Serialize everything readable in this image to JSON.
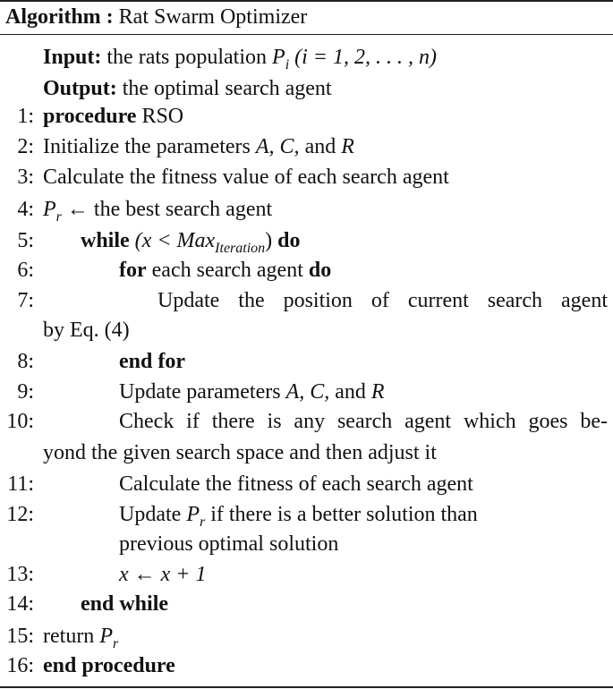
{
  "algorithm": {
    "label": "Algorithm :",
    "name": "Rat Swarm Optimizer"
  },
  "input": {
    "label": "Input:",
    "text_pre": "the rats population",
    "var": "P",
    "sub": "i",
    "range_text": "(i = 1, 2, . . . , n)"
  },
  "output": {
    "label": "Output:",
    "text": "the optimal search agent"
  },
  "lines": {
    "l1": {
      "num": "1:",
      "kw": "procedure",
      "text": "RSO"
    },
    "l2": {
      "num": "2:",
      "text": "Initialize the parameters",
      "vars": "A, C,",
      "and": "and",
      "var_r": "R"
    },
    "l3": {
      "num": "3:",
      "text": "Calculate the fitness value of each search agent"
    },
    "l4": {
      "num": "4:",
      "var": "P",
      "sub": "r",
      "text": "← the best search agent"
    },
    "l5": {
      "num": "5:",
      "kw": "while",
      "cond_open": "(x <",
      "cond_var": "Max",
      "cond_sub": "Iteration",
      "cond_close": ")",
      "kw2": "do"
    },
    "l6": {
      "num": "6:",
      "kw": "for",
      "text": "each search agent",
      "kw2": "do"
    },
    "l7": {
      "num": "7:",
      "text": "Update the position of current search agent",
      "cont": "by Eq. (4)"
    },
    "l8": {
      "num": "8:",
      "kw": "end for"
    },
    "l9": {
      "num": "9:",
      "text": "Update parameters",
      "vars": "A, C,",
      "and": "and",
      "var_r": "R"
    },
    "l10": {
      "num": "10:",
      "text": "Check if there is any search agent which goes be-",
      "cont": "yond the given search space and then adjust it"
    },
    "l11": {
      "num": "11:",
      "text": "Calculate the fitness of each search agent"
    },
    "l12": {
      "num": "12:",
      "text_pre": "Update",
      "var": "P",
      "sub": "r",
      "text_post": "if there is a better solution than",
      "cont": "previous optimal solution"
    },
    "l13": {
      "num": "13:",
      "expr": "x ← x + 1"
    },
    "l14": {
      "num": "14:",
      "kw": "end while"
    },
    "l15": {
      "num": "15:",
      "text": "return",
      "var": "P",
      "sub": "r"
    },
    "l16": {
      "num": "16:",
      "kw": "end procedure"
    }
  }
}
